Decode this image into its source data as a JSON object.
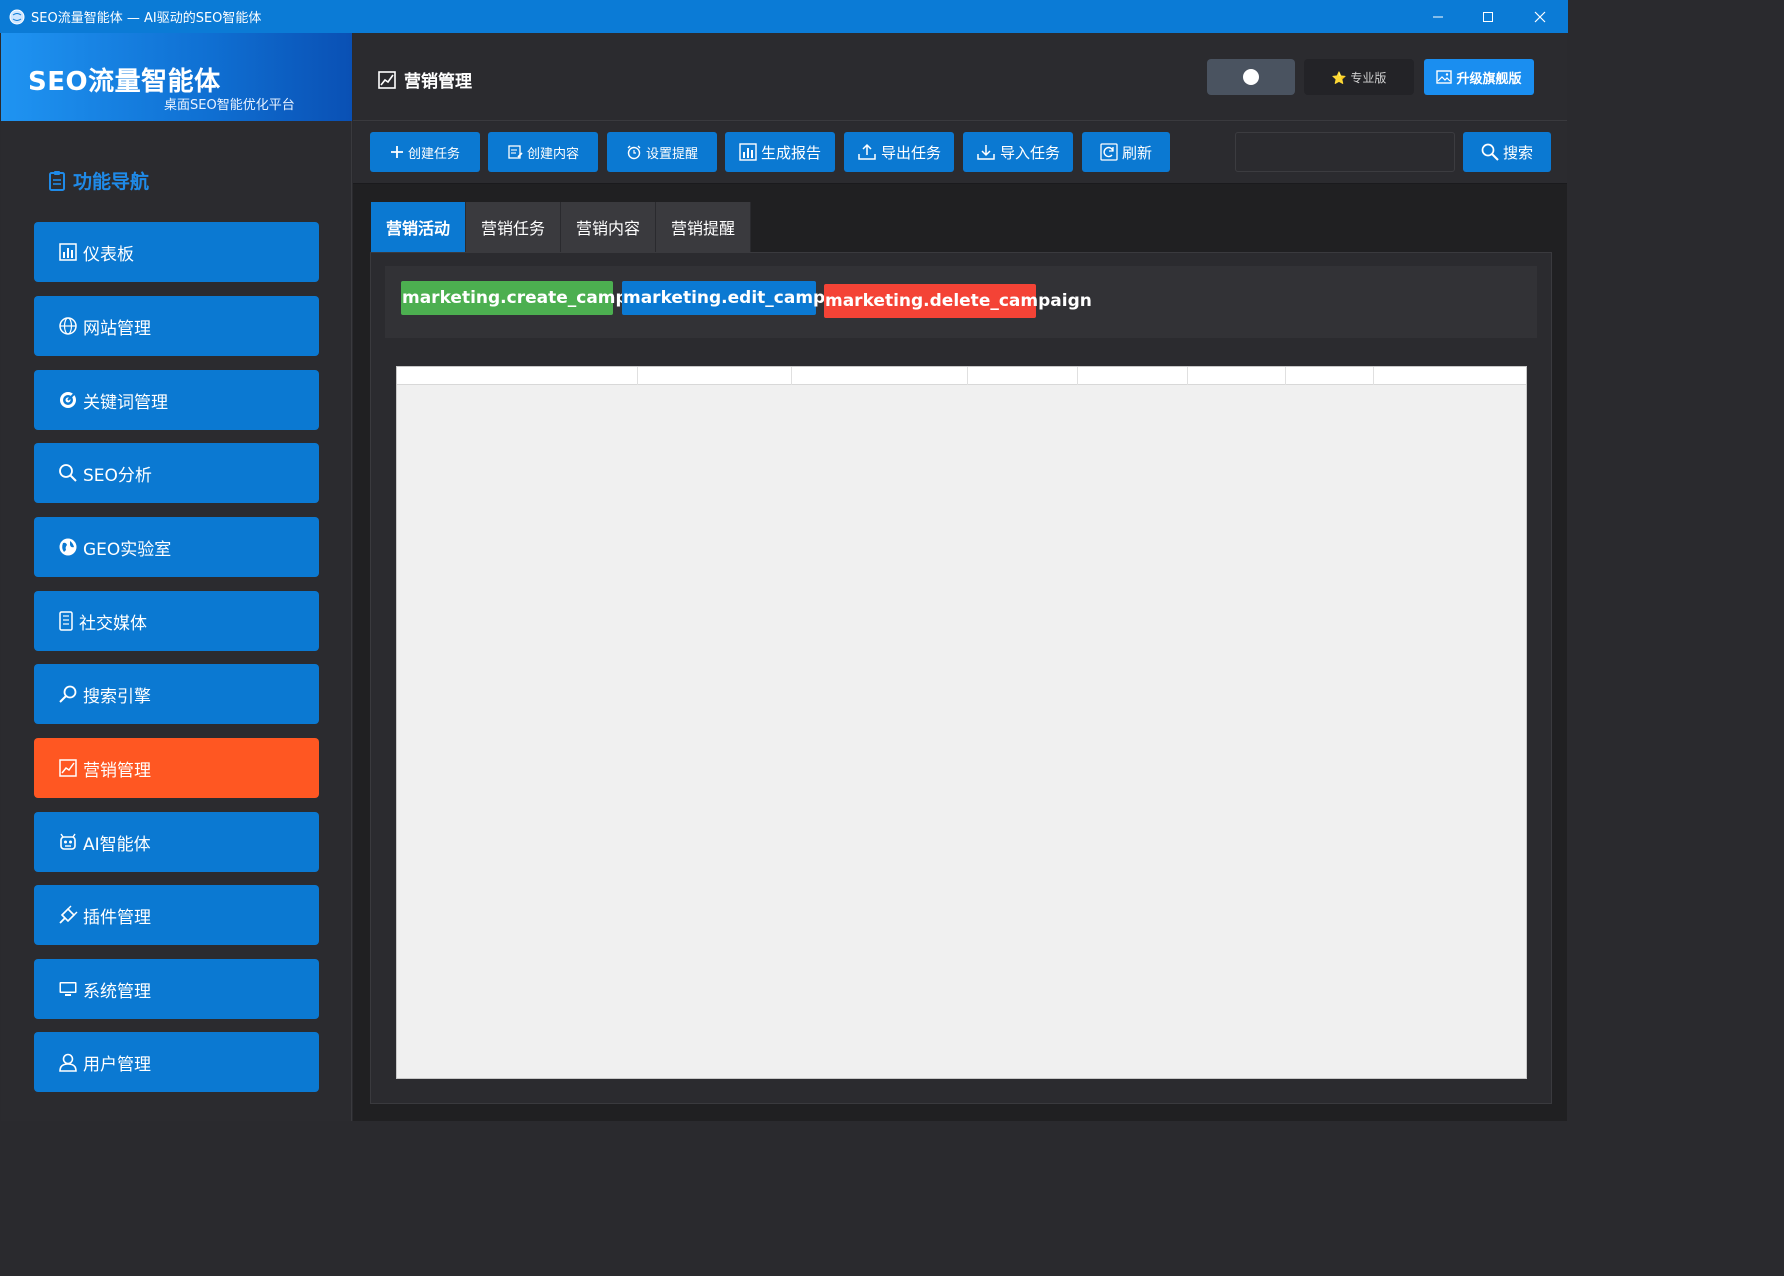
{
  "window": {
    "title": "SEO流量智能体 — AI驱动的SEO智能体"
  },
  "brand": {
    "name": "SEO流量智能体",
    "subtitle": "桌面SEO智能优化平台"
  },
  "sidebar": {
    "heading": "功能导航",
    "items": [
      {
        "label": "仪表板",
        "icon": "bar-chart-icon",
        "active": false
      },
      {
        "label": "网站管理",
        "icon": "globe-icon",
        "active": false
      },
      {
        "label": "关键词管理",
        "icon": "target-icon",
        "active": false
      },
      {
        "label": "SEO分析",
        "icon": "search-icon",
        "active": false
      },
      {
        "label": "GEO实验室",
        "icon": "earth-icon",
        "active": false
      },
      {
        "label": "社交媒体",
        "icon": "phone-icon",
        "active": false
      },
      {
        "label": "搜索引擎",
        "icon": "magnifier-icon",
        "active": false
      },
      {
        "label": "营销管理",
        "icon": "chart-up-icon",
        "active": true
      },
      {
        "label": "AI智能体",
        "icon": "robot-icon",
        "active": false
      },
      {
        "label": "插件管理",
        "icon": "plug-icon",
        "active": false
      },
      {
        "label": "系统管理",
        "icon": "monitor-icon",
        "active": false
      },
      {
        "label": "用户管理",
        "icon": "user-icon",
        "active": false
      }
    ]
  },
  "header": {
    "page_title": "营销管理",
    "pro_label": "⭐ 专业版",
    "upgrade_label": "升级旗舰版"
  },
  "toolbar": {
    "buttons": [
      {
        "label": "创建任务",
        "icon": "plus-icon"
      },
      {
        "label": "创建内容",
        "icon": "edit-icon"
      },
      {
        "label": "设置提醒",
        "icon": "alarm-icon"
      },
      {
        "label": "生成报告",
        "icon": "report-icon"
      },
      {
        "label": "导出任务",
        "icon": "export-icon"
      },
      {
        "label": "导入任务",
        "icon": "import-icon"
      },
      {
        "label": "刷新",
        "icon": "refresh-icon"
      }
    ],
    "search_value": "",
    "search_button": "搜索"
  },
  "tabs": [
    {
      "label": "营销活动",
      "active": true
    },
    {
      "label": "营销任务",
      "active": false
    },
    {
      "label": "营销内容",
      "active": false
    },
    {
      "label": "营销提醒",
      "active": false
    }
  ],
  "permissions": [
    {
      "label": "marketing.create_campaign",
      "color": "#4caf50"
    },
    {
      "label": "marketing.edit_campaign",
      "color": "#0b79d2"
    },
    {
      "label": "marketing.delete_campaign",
      "color": "#f44336"
    }
  ],
  "colors": {
    "accent": "#0b79d2",
    "active_nav": "#ff5722",
    "titlebar": "#0b7bd6"
  }
}
